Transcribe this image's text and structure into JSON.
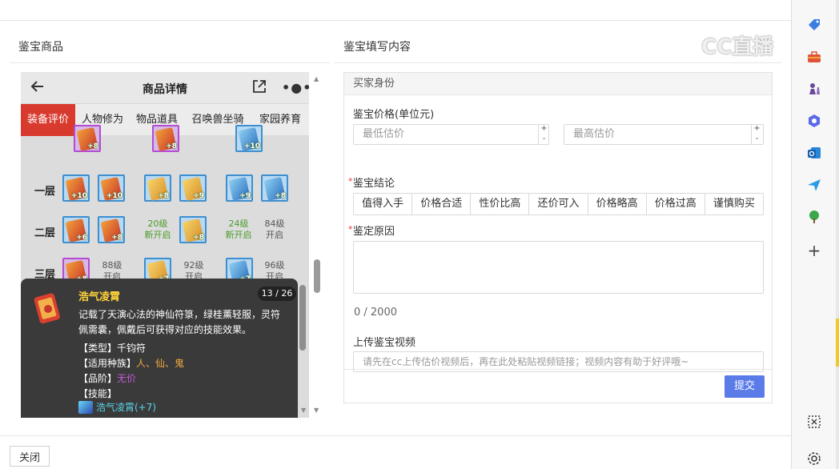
{
  "left_section": {
    "title": "鉴宝商品"
  },
  "right_section": {
    "title": "鉴宝填写内容"
  },
  "phone": {
    "title": "商品详情",
    "tabs": [
      "装备评价",
      "人物修为",
      "物品道具",
      "召唤兽坐骑",
      "家园养育"
    ],
    "rows": [
      {
        "label": "一层"
      },
      {
        "label": "二层"
      },
      {
        "label": "三层"
      }
    ],
    "slot_plus": {
      "top": [
        "+8",
        "+8",
        "+10"
      ],
      "r1": [
        "+10",
        "+10",
        "+8",
        "+9",
        "+9",
        "+8"
      ],
      "r2": [
        "+6",
        "+8",
        "+8"
      ],
      "r3": [
        "+8",
        "+7",
        "+7"
      ]
    },
    "locked": {
      "r2c3": [
        "20级",
        "新开启"
      ],
      "r2c5": [
        "24级",
        "新开启"
      ],
      "r2c6": [
        "84级",
        "开启"
      ],
      "r3c2": [
        "88级",
        "开启"
      ],
      "r3c4": [
        "92级",
        "开启"
      ],
      "r3c6": [
        "96级",
        "开启"
      ]
    },
    "tooltip": {
      "name": "浩气凌霄",
      "page": "13 / 26",
      "description": "记载了天演心法的神仙符箓，绿桂薰轻服，灵符佩需囊，佩戴后可获得对应的技能效果。",
      "type_label": "【类型】",
      "type_value": "千钧符",
      "race_label": "【适用种族】",
      "race_value": "人、仙、鬼",
      "grade_label": "【品阶】",
      "grade_value": "无价",
      "skill_label": "【技能】",
      "skill_value": "浩气凌霄(+7)"
    }
  },
  "form": {
    "header": "买家身份",
    "price_label": "鉴宝价格(单位元)",
    "min_placeholder": "最低估价",
    "max_placeholder": "最高估价",
    "stepper_plus": "+",
    "stepper_minus": "-",
    "required_mark": "*",
    "conclusion_label": "鉴宝结论",
    "conclusion_options": [
      "值得入手",
      "价格合适",
      "性价比高",
      "还价可入",
      "价格略高",
      "价格过高",
      "谨慎购买"
    ],
    "reason_label": "鉴定原因",
    "counter": "0 / 2000",
    "video_label": "上传鉴宝视频",
    "video_placeholder": "请先在cc上传估价视频后，再在此处粘贴视频链接；视频内容有助于好评哦~",
    "submit_label": "提交"
  },
  "footer": {
    "close_label": "关闭"
  },
  "watermark": "CC直播",
  "sidebar_icons": [
    "tag-icon",
    "toolbox-icon",
    "chess-icon",
    "copilot-icon",
    "outlook-icon",
    "send-icon",
    "tree-icon",
    "add-icon",
    "screenshot-icon",
    "settings-icon"
  ],
  "colors": {
    "accent_red": "#d93a2e",
    "submit_blue": "#5b7be8",
    "tooltip_bg": "#3a3a3a",
    "name_gold": "#ffd23a",
    "skill_cyan": "#56d4ea"
  }
}
